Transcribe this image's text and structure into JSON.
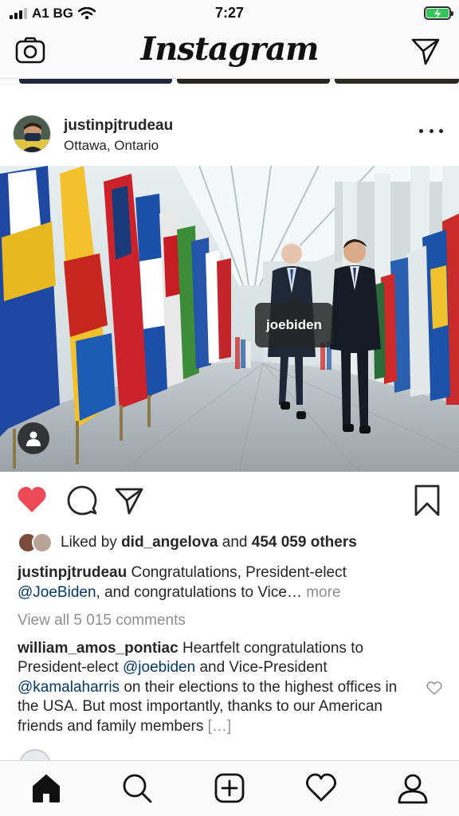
{
  "status_bar": {
    "carrier": "A1 BG",
    "time": "7:27"
  },
  "app": {
    "title": "Instagram",
    "icons": [
      "camera-icon",
      "direct-message-icon"
    ]
  },
  "post": {
    "username": "justinpjtrudeau",
    "location": "Ottawa, Ontario",
    "photo_tag": "joebiden",
    "liked_by_prefix": "Liked by",
    "liked_by_user": "did_angelova",
    "liked_by_and": "and",
    "liked_by_others": "454 059 others",
    "caption_user": "justinpjtrudeau",
    "caption_text_1": "Congratulations, President-elect",
    "caption_mention": "@JoeBiden",
    "caption_text_2": ", and congratulations to Vice…",
    "caption_more": "more",
    "view_all_comments": "View all 5 015 comments",
    "liked": true
  },
  "comment": {
    "user": "william_amos_pontiac",
    "text_1": "Heartfelt congratulations to President-elect",
    "mention_1": "@joebiden",
    "text_2": "and Vice-President",
    "mention_2": "@kamalaharris",
    "text_3": "on their elections to the highest offices in the USA. But most importantly, thanks to our American friends and family members",
    "ellipsis": "[…]"
  },
  "colors": {
    "like_red": "#ed4956",
    "mention_blue": "#00376b",
    "muted_gray": "#8e8e8e",
    "battery_green": "#35c759"
  },
  "bottom_nav": [
    "home-icon",
    "search-icon",
    "new-post-icon",
    "activity-icon",
    "profile-icon"
  ]
}
